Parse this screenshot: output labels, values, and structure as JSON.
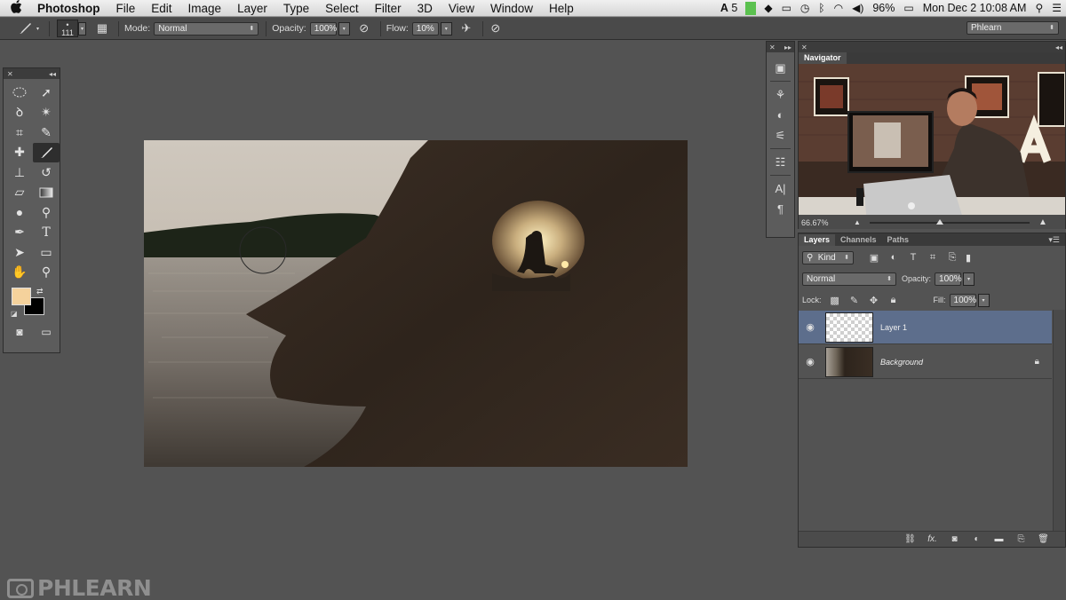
{
  "menubar": {
    "apple": "",
    "app_name": "Photoshop",
    "items": [
      "File",
      "Edit",
      "Image",
      "Layer",
      "Type",
      "Select",
      "Filter",
      "3D",
      "View",
      "Window",
      "Help"
    ],
    "status": {
      "adobe_count": "5",
      "battery": "96%",
      "datetime": "Mon Dec 2  10:08 AM"
    }
  },
  "options_bar": {
    "brush_size": "111",
    "mode_label": "Mode:",
    "mode_value": "Normal",
    "opacity_label": "Opacity:",
    "opacity_value": "100%",
    "flow_label": "Flow:",
    "flow_value": "10%",
    "workspace": "Phlearn"
  },
  "tools_panel": {
    "foreground_color": "#f5d29c",
    "background_color": "#000000"
  },
  "navigator": {
    "title": "Navigator",
    "zoom": "66.67%"
  },
  "layers_panel": {
    "tabs": [
      "Layers",
      "Channels",
      "Paths"
    ],
    "kind_label": "Kind",
    "blend_mode": "Normal",
    "opacity_label": "Opacity:",
    "opacity_value": "100%",
    "lock_label": "Lock:",
    "fill_label": "Fill:",
    "fill_value": "100%",
    "layers": [
      {
        "name": "Layer 1",
        "selected": true,
        "visible": true
      },
      {
        "name": "Background",
        "selected": false,
        "visible": true,
        "locked": true
      }
    ],
    "footer_fx": "fx."
  },
  "watermark": {
    "text": "PHLEARN"
  }
}
